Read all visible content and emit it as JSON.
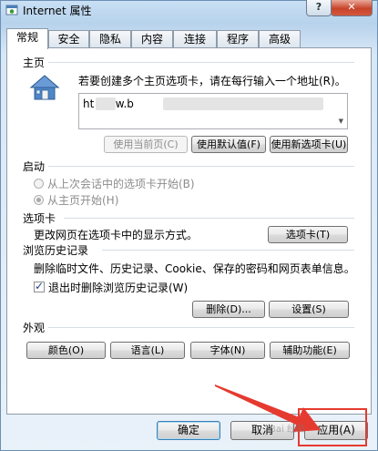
{
  "window": {
    "title": "Internet 属性",
    "help_label": "?",
    "close_label": "✕"
  },
  "tabs": [
    "常规",
    "安全",
    "隐私",
    "内容",
    "连接",
    "程序",
    "高级"
  ],
  "home": {
    "section_title": "主页",
    "instruction": "若要创建多个主页选项卡，请在每行输入一个地址(R)。",
    "url_visible": "ht     www.b",
    "buttons": [
      "使用当前页(C)",
      "使用默认值(F)",
      "使用新选项卡(U)"
    ]
  },
  "startup": {
    "section_title": "启动",
    "option_last_session": "从上次会话中的选项卡开始(B)",
    "option_home": "从主页开始(H)"
  },
  "tabs_section": {
    "section_title": "选项卡",
    "description": "更改网页在选项卡中的显示方式。",
    "button": "选项卡(T)"
  },
  "history": {
    "section_title": "浏览历史记录",
    "description": "删除临时文件、历史记录、Cookie、保存的密码和网页表单信息。",
    "checkbox_label": "退出时删除浏览历史记录(W)",
    "checkbox_checked": true,
    "delete_button": "删除(D)...",
    "settings_button": "设置(S)"
  },
  "appearance": {
    "section_title": "外观",
    "buttons": [
      "颜色(O)",
      "语言(L)",
      "字体(N)",
      "辅助功能(E)"
    ]
  },
  "footer": {
    "ok": "确定",
    "cancel": "取消",
    "apply": "应用(A)"
  },
  "watermark": "Bai 经验",
  "annotation_color": "#e53a2f"
}
